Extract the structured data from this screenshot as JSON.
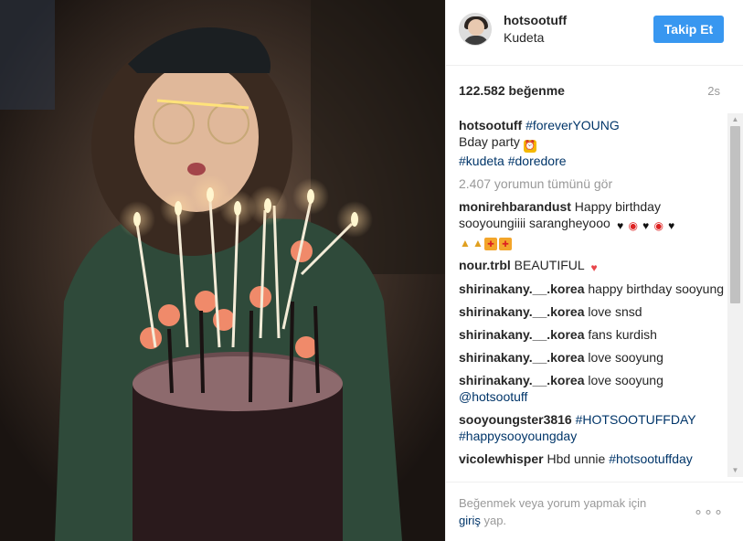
{
  "header": {
    "username": "hotsootuff",
    "location": "Kudeta",
    "follow_label": "Takip Et"
  },
  "stats": {
    "likes": "122.582 beğenme",
    "time": "2s"
  },
  "caption": {
    "user": "hotsootuff",
    "line1_tag": "#foreverYOUNG",
    "line2": "Bday party",
    "tag2": "#kudeta",
    "tag3": "#doredore"
  },
  "view_all": "2.407 yorumun tümünü gör",
  "comments": [
    {
      "user": "monirehbarandust",
      "text": "Happy birthday sooyoungiiii sarangheyooo"
    },
    {
      "user": "nour.trbl",
      "text": "BEAUTIFUL"
    },
    {
      "user": "shirinakany.__.korea",
      "text": "happy birthday sooyung"
    },
    {
      "user": "shirinakany.__.korea",
      "text": "love snsd"
    },
    {
      "user": "shirinakany.__.korea",
      "text": "fans kurdish"
    },
    {
      "user": "shirinakany.__.korea",
      "text": "love sooyung"
    },
    {
      "user": "shirinakany.__.korea",
      "text": "love sooyung",
      "tag": "@hotsootuff"
    },
    {
      "user": "sooyoungster3816",
      "tag": "#HOTSOOTUFFDAY",
      "tag2": "#happysooyoungday"
    },
    {
      "user": "vicolewhisper",
      "text": "Hbd unnie",
      "tag": "#hotsootuffday"
    }
  ],
  "footer": {
    "text": "Beğenmek veya yorum yapmak için",
    "link": "giriş",
    "text_after": "yap.",
    "more_label": "∘∘∘"
  },
  "icons": {
    "heart": "♥",
    "lips": "💋",
    "gift": "🎁",
    "party": "🎉",
    "up": "▲",
    "down": "▼"
  },
  "colors": {
    "accent": "#3897f0",
    "link": "#003569",
    "muted": "#999999"
  }
}
